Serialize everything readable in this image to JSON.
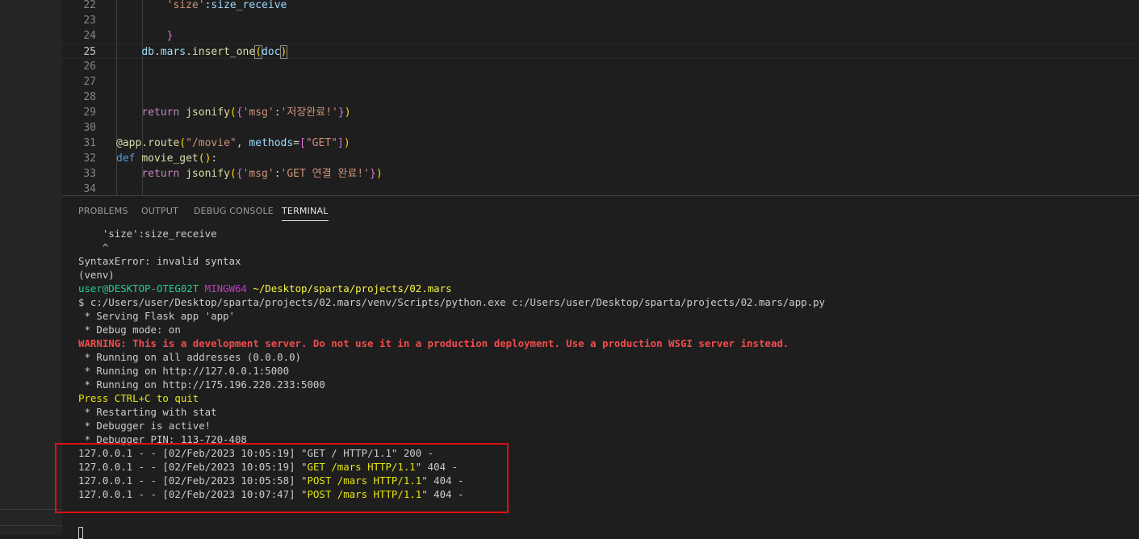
{
  "editor": {
    "lines": [
      {
        "num": "22",
        "tokens": [
          {
            "t": "        ",
            "c": ""
          },
          {
            "t": "'size'",
            "c": "str"
          },
          {
            "t": ":",
            "c": ""
          },
          {
            "t": "size_receive",
            "c": "var"
          }
        ]
      },
      {
        "num": "23",
        "tokens": []
      },
      {
        "num": "24",
        "tokens": [
          {
            "t": "        ",
            "c": ""
          },
          {
            "t": "}",
            "c": "br2"
          }
        ]
      },
      {
        "num": "25",
        "tokens": [
          {
            "t": "    ",
            "c": ""
          },
          {
            "t": "db",
            "c": "var"
          },
          {
            "t": ".",
            "c": ""
          },
          {
            "t": "mars",
            "c": "var"
          },
          {
            "t": ".",
            "c": ""
          },
          {
            "t": "insert_one",
            "c": "fn"
          },
          {
            "t": "(",
            "c": "br1 bm"
          },
          {
            "t": "doc",
            "c": "var"
          },
          {
            "t": ")",
            "c": "br1 bm"
          }
        ]
      },
      {
        "num": "26",
        "tokens": []
      },
      {
        "num": "27",
        "tokens": []
      },
      {
        "num": "28",
        "tokens": []
      },
      {
        "num": "29",
        "tokens": [
          {
            "t": "    ",
            "c": ""
          },
          {
            "t": "return",
            "c": "kw"
          },
          {
            "t": " ",
            "c": ""
          },
          {
            "t": "jsonify",
            "c": "fn"
          },
          {
            "t": "(",
            "c": "br1"
          },
          {
            "t": "{",
            "c": "br2"
          },
          {
            "t": "'msg'",
            "c": "str"
          },
          {
            "t": ":",
            "c": ""
          },
          {
            "t": "'저장완료!'",
            "c": "str"
          },
          {
            "t": "}",
            "c": "br2"
          },
          {
            "t": ")",
            "c": "br1"
          }
        ]
      },
      {
        "num": "30",
        "tokens": []
      },
      {
        "num": "31",
        "tokens": [
          {
            "t": "@app.route",
            "c": "fn"
          },
          {
            "t": "(",
            "c": "br1"
          },
          {
            "t": "\"/movie\"",
            "c": "str"
          },
          {
            "t": ", ",
            "c": ""
          },
          {
            "t": "methods",
            "c": "var"
          },
          {
            "t": "=",
            "c": ""
          },
          {
            "t": "[",
            "c": "br2"
          },
          {
            "t": "\"GET\"",
            "c": "str"
          },
          {
            "t": "]",
            "c": "br2"
          },
          {
            "t": ")",
            "c": "br1"
          }
        ]
      },
      {
        "num": "32",
        "tokens": [
          {
            "t": "def",
            "c": "kwb"
          },
          {
            "t": " ",
            "c": ""
          },
          {
            "t": "movie_get",
            "c": "fn"
          },
          {
            "t": "(",
            "c": "br1"
          },
          {
            "t": ")",
            "c": "br1"
          },
          {
            "t": ":",
            "c": ""
          }
        ]
      },
      {
        "num": "33",
        "tokens": [
          {
            "t": "    ",
            "c": ""
          },
          {
            "t": "return",
            "c": "kw"
          },
          {
            "t": " ",
            "c": ""
          },
          {
            "t": "jsonify",
            "c": "fn"
          },
          {
            "t": "(",
            "c": "br1"
          },
          {
            "t": "{",
            "c": "br2"
          },
          {
            "t": "'msg'",
            "c": "str"
          },
          {
            "t": ":",
            "c": ""
          },
          {
            "t": "'GET 연결 완료!'",
            "c": "str"
          },
          {
            "t": "}",
            "c": "br2"
          },
          {
            "t": ")",
            "c": "br1"
          }
        ]
      },
      {
        "num": "34",
        "tokens": []
      }
    ],
    "active_line": "25"
  },
  "panel": {
    "tabs": [
      {
        "label": "PROBLEMS",
        "active": false
      },
      {
        "label": "OUTPUT",
        "active": false
      },
      {
        "label": "DEBUG CONSOLE",
        "active": false
      },
      {
        "label": "TERMINAL",
        "active": true
      }
    ]
  },
  "terminal": {
    "lines": [
      [
        {
          "t": "    'size':size_receive",
          "c": ""
        }
      ],
      [
        {
          "t": "    ^",
          "c": ""
        }
      ],
      [
        {
          "t": "SyntaxError: invalid syntax",
          "c": ""
        }
      ],
      [
        {
          "t": "(venv)",
          "c": ""
        }
      ],
      [
        {
          "t": "user@DESKTOP-OTEG02T",
          "c": "t-green"
        },
        {
          "t": " ",
          "c": ""
        },
        {
          "t": "MINGW64",
          "c": "t-magenta"
        },
        {
          "t": " ",
          "c": ""
        },
        {
          "t": "~/Desktop/sparta/projects/02.mars",
          "c": "t-yellow"
        }
      ],
      [
        {
          "t": "$ c:/Users/user/Desktop/sparta/projects/02.mars/venv/Scripts/python.exe c:/Users/user/Desktop/sparta/projects/02.mars/app.py",
          "c": ""
        }
      ],
      [
        {
          "t": " * Serving Flask app 'app'",
          "c": ""
        }
      ],
      [
        {
          "t": " * Debug mode: on",
          "c": ""
        }
      ],
      [
        {
          "t": "WARNING: This is a development server. Do not use it in a production deployment. Use a production WSGI server instead.",
          "c": "t-red"
        }
      ],
      [
        {
          "t": " * Running on all addresses (0.0.0.0)",
          "c": ""
        }
      ],
      [
        {
          "t": " * Running on http://127.0.0.1:5000",
          "c": ""
        }
      ],
      [
        {
          "t": " * Running on http://175.196.220.233:5000",
          "c": ""
        }
      ],
      [
        {
          "t": "Press CTRL+C to quit",
          "c": "t-yel2"
        }
      ],
      [
        {
          "t": " * Restarting with stat",
          "c": ""
        }
      ],
      [
        {
          "t": " * Debugger is active!",
          "c": ""
        }
      ],
      [
        {
          "t": " * Debugger PIN: 113-720-408",
          "c": ""
        }
      ],
      [
        {
          "t": "127.0.0.1 - - [02/Feb/2023 10:05:19] \"GET / HTTP/1.1\" 200 -",
          "c": ""
        }
      ],
      [
        {
          "t": "127.0.0.1 - - [02/Feb/2023 10:05:19] \"",
          "c": ""
        },
        {
          "t": "GET /mars HTTP/1.1",
          "c": "t-yel2"
        },
        {
          "t": "\" 404 -",
          "c": ""
        }
      ],
      [
        {
          "t": "127.0.0.1 - - [02/Feb/2023 10:05:58] \"",
          "c": ""
        },
        {
          "t": "POST /mars HTTP/1.1",
          "c": "t-yel2"
        },
        {
          "t": "\" 404 -",
          "c": ""
        }
      ],
      [
        {
          "t": "127.0.0.1 - - [02/Feb/2023 10:07:47] \"",
          "c": ""
        },
        {
          "t": "POST /mars HTTP/1.1",
          "c": "t-yel2"
        },
        {
          "t": "\" 404 -",
          "c": ""
        }
      ]
    ]
  },
  "colors": {
    "background": "#1e1e1e",
    "annotation_box": "#e01010",
    "prompt_user": "#23d18b",
    "prompt_shell": "#bc3fbc",
    "prompt_path": "#f5f543",
    "warning": "#f14c4c"
  }
}
